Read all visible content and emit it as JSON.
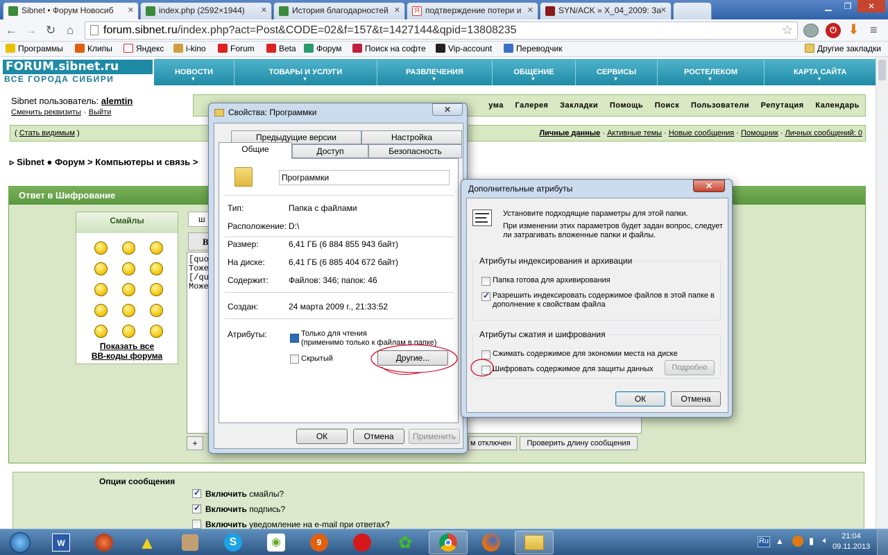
{
  "browser": {
    "tabs": [
      {
        "title": "Sibnet • Форум Новосиб",
        "color": "#3c8a3c"
      },
      {
        "title": "index.php (2592×1944)",
        "color": "#3c8a3c"
      },
      {
        "title": "История благодарностей",
        "color": "#3c8a3c"
      },
      {
        "title": "подтверждение потери и",
        "color": "#d23c3c"
      },
      {
        "title": "SYN/ACK » X_04_2009: За",
        "color": "#8a1a1a"
      }
    ],
    "url_host": "forum.sibnet.ru",
    "url_path": "/index.php?act=Post&CODE=02&f=157&t=1427144&qpid=13808235",
    "bookmarks": [
      "Программы",
      "Клипы",
      "Яндекс",
      "i-kino",
      "Forum",
      "Beta",
      "Форум",
      "Поиск на софте",
      "Vip-account",
      "Переводчик"
    ],
    "other_bookmarks": "Другие закладки"
  },
  "site": {
    "logo_top": "FORUM.sibnet.ru",
    "logo_bottom": "ВСЕ ГОРОДА СИБИРИ",
    "nav": [
      "НОВОСТИ",
      "ТОВАРЫ И УСЛУГИ",
      "РАЗВЛЕЧЕНИЯ",
      "ОБЩЕНИЕ",
      "СЕРВИСЫ",
      "РОСТЕЛЕКОМ",
      "КАРТА САЙТА"
    ],
    "user_label": "Sibnet пользователь:",
    "username": "alemtin",
    "change_details": "Сменить реквизиты",
    "logout": "Выйти",
    "top_links": [
      "ума",
      "Галерея",
      "Закладки",
      "Помощь",
      "Поиск",
      "Пользователи",
      "Репутация",
      "Календарь"
    ],
    "become_visible": "Стать видимым",
    "user_links": [
      "Личные данные",
      "Активные темы",
      "Новые сообщения",
      "Помощник",
      "Личных сообщений: 0"
    ],
    "breadcrumb": [
      "Sibnet",
      "Форум",
      "Компьютеры и связь"
    ],
    "reply_title": "Ответ в Шифрование",
    "smilies_title": "Смайлы",
    "show_all": "Показать все",
    "bbcodes": "BB-коды форума",
    "editor_lines": [
      "[quo",
      "Тоже",
      "[/quo",
      "Може"
    ],
    "editor_prefix": "ш",
    "editor_b": "B",
    "plus_btn": "+",
    "disabled_text": "м отключен",
    "check_length": "Проверить длину сообщения",
    "options_title": "Опции сообщения",
    "options": [
      {
        "bold": "Включить",
        "text": "смайлы?",
        "checked": true
      },
      {
        "bold": "Включить",
        "text": "подпись?",
        "checked": true
      },
      {
        "bold": "Включить",
        "text": "уведомление на e-mail при ответах?",
        "checked": false
      }
    ]
  },
  "props": {
    "title": "Свойства: Программки",
    "tabs_row1": [
      "Предыдущие версии",
      "Настройка"
    ],
    "tabs_row2": [
      "Общие",
      "Доступ",
      "Безопасность"
    ],
    "name": "Программки",
    "rows": [
      {
        "k": "Тип:",
        "v": "Папка с файлами"
      },
      {
        "k": "Расположение:",
        "v": "D:\\"
      },
      {
        "k": "Размер:",
        "v": "6,41 ГБ (6 884 855 943 байт)"
      },
      {
        "k": "На диске:",
        "v": "6,41 ГБ (6 885 404 672 байт)"
      },
      {
        "k": "Содержит:",
        "v": "Файлов: 346; папок: 46"
      },
      {
        "k": "Создан:",
        "v": "24 марта 2009 г., 21:33:52"
      }
    ],
    "attrs_label": "Атрибуты:",
    "readonly": "Только для чтения",
    "readonly_note": "(применимо только к файлам в папке)",
    "hidden": "Скрытый",
    "other_btn": "Другие...",
    "ok": "ОК",
    "cancel": "Отмена",
    "apply": "Применить"
  },
  "adv": {
    "title": "Дополнительные атрибуты",
    "intro1": "Установите подходящие параметры для этой папки.",
    "intro2": "При изменении этих параметров будет задан вопрос, следует ли затрагивать вложенные папки и файлы.",
    "group1": "Атрибуты индексирования и архивации",
    "archive": "Папка готова для архивирования",
    "index": "Разрешить индексировать содержимое файлов в этой папке в дополнение к свойствам файла",
    "group2": "Атрибуты сжатия и шифрования",
    "compress": "Сжимать содержимое для экономии места на диске",
    "encrypt": "Шифровать содержимое для защиты данных",
    "details": "Подробно",
    "ok": "ОК",
    "cancel": "Отмена"
  },
  "taskbar": {
    "lang": "Ru",
    "time": "21:04",
    "date": "09.11.2013"
  }
}
